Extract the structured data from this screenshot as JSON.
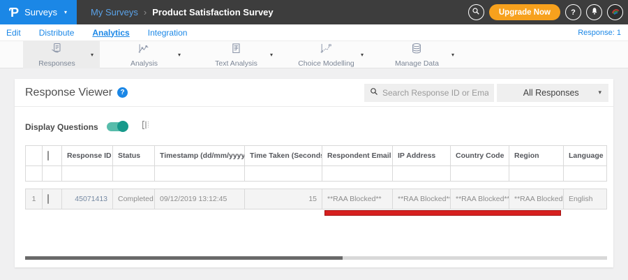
{
  "topbar": {
    "logo_glyph": "Ƥ",
    "product": "Surveys",
    "breadcrumb": {
      "parent": "My Surveys",
      "separator": "›",
      "current": "Product Satisfaction Survey"
    },
    "upgrade_label": "Upgrade Now"
  },
  "icons": {
    "caret_down": "▾",
    "question": "?"
  },
  "navbar": {
    "items": [
      {
        "label": "Edit"
      },
      {
        "label": "Distribute"
      },
      {
        "label": "Analytics"
      },
      {
        "label": "Integration"
      }
    ],
    "response_count": "Response: 1"
  },
  "toolbar": {
    "items": [
      {
        "label": "Responses"
      },
      {
        "label": "Analysis"
      },
      {
        "label": "Text Analysis"
      },
      {
        "label": "Choice Modelling"
      },
      {
        "label": "Manage Data"
      }
    ]
  },
  "viewer": {
    "title": "Response Viewer",
    "search_placeholder": "Search Response ID or Email",
    "filter_selected": "All Responses",
    "display_questions_label": "Display Questions"
  },
  "table": {
    "sort_caret": "▾",
    "sort_updown": "⇅",
    "headers": {
      "response_id": "Response ID",
      "status": "Status",
      "timestamp": "Timestamp (dd/mm/yyyy)",
      "time_taken": "Time Taken (Seconds)",
      "respondent_email": "Respondent Email",
      "ip_address": "IP Address",
      "country_code": "Country Code",
      "region": "Region",
      "language": "Language"
    },
    "rows": [
      {
        "num": "1",
        "response_id": "45071413",
        "status": "Completed",
        "timestamp": "09/12/2019 13:12:45",
        "time_taken": "15",
        "respondent_email": "**RAA Blocked**",
        "ip_address": "**RAA Blocked**",
        "country_code": "**RAA Blocked**",
        "region": "**RAA Blocked**",
        "language": "English"
      }
    ]
  },
  "colors": {
    "brand_blue": "#1b87e6",
    "upgrade_orange": "#f7a11d",
    "annotation_red": "#d6201f",
    "toggle_teal": "#17998b"
  }
}
